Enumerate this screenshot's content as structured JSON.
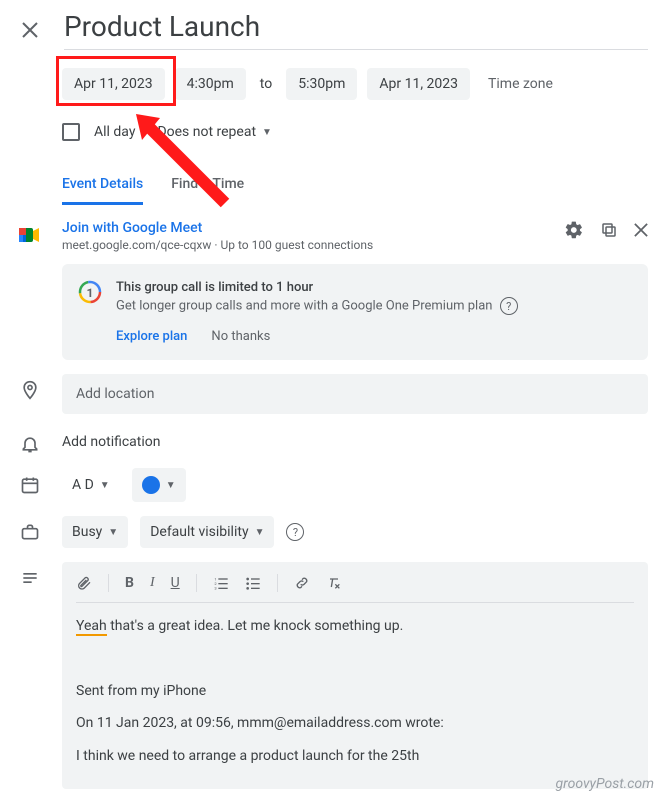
{
  "title": "Product Launch",
  "date_start": "Apr 11, 2023",
  "time_start": "4:30pm",
  "to_label": "to",
  "time_end": "5:30pm",
  "date_end": "Apr 11, 2023",
  "timezone_label": "Time zone",
  "all_day_label": "All day",
  "repeat_label": "Does not repeat",
  "tabs": {
    "details": "Event Details",
    "find_time": "Find a Time"
  },
  "meet": {
    "join_label": "Join with Google Meet",
    "url": "meet.google.com/qce-cqxw",
    "guest_info": "Up to 100 guest connections"
  },
  "one_banner": {
    "title": "This group call is limited to 1 hour",
    "subtitle": "Get longer group calls and more with a Google One Premium plan",
    "explore": "Explore plan",
    "no_thanks": "No thanks"
  },
  "location_placeholder": "Add location",
  "notification_label": "Add notification",
  "calendar_owner": "A D",
  "busy_label": "Busy",
  "visibility_label": "Default visibility",
  "description": {
    "line1_prefix": "Yeah",
    "line1_rest": " that's a great idea. Let me knock something up.",
    "line2": "Sent from my iPhone",
    "line3": "On 11 Jan 2023, at 09:56, mmm@emailaddress.com wrote:",
    "line4": "I think we need to arrange a product launch for the 25th"
  },
  "watermark": "groovyPost.com"
}
